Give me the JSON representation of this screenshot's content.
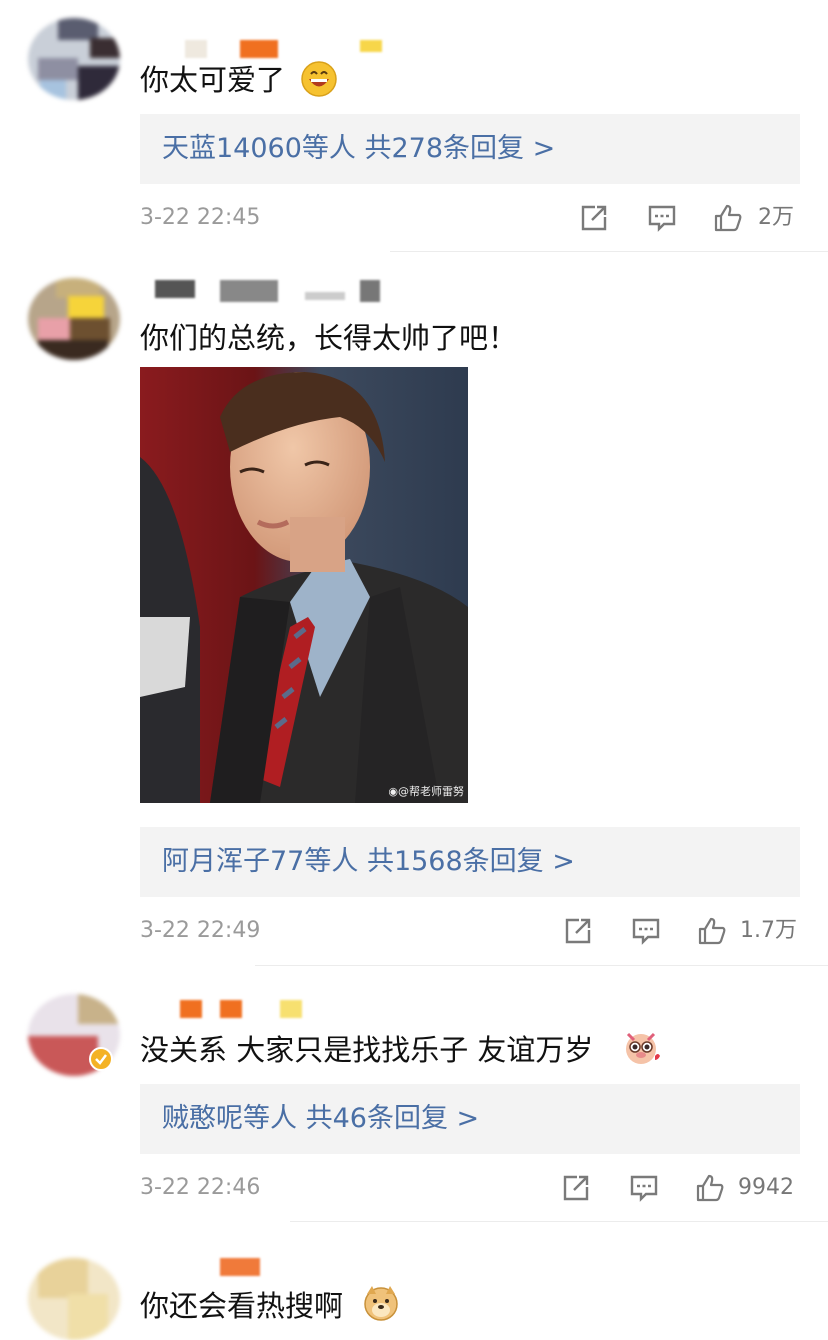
{
  "comments": [
    {
      "text": "你太可爱了",
      "reply_label": "天蓝14060等人  共278条回复 >",
      "time": "3-22 22:45",
      "likes": "2万",
      "emoji": "grinning-face-icon"
    },
    {
      "text": "你们的总统，长得太帅了吧！",
      "image_watermark": "@帮老师雷努",
      "reply_label": "阿月浑子77等人  共1568条回复 >",
      "time": "3-22 22:49",
      "likes": "1.7万"
    },
    {
      "text": "没关系 大家只是找找乐子 友谊万岁",
      "reply_label": "贼憨呢等人  共46条回复 >",
      "time": "3-22 22:46",
      "likes": "9942",
      "emoji": "cute-pig-icon"
    },
    {
      "text": "你还会看热搜啊",
      "emoji": "doge-icon"
    }
  ],
  "colors": {
    "link": "#4a6fa5",
    "reply_bg": "#f3f3f3",
    "meta": "#9a9a9a"
  }
}
